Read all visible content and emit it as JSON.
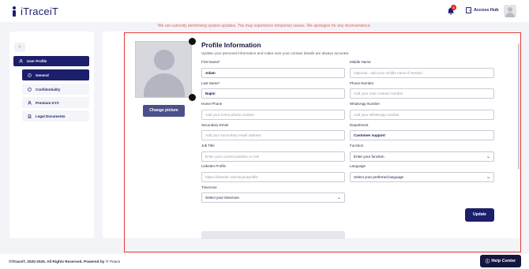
{
  "header": {
    "logo_text": "iTraceiT",
    "notification_count": "3",
    "access_hub_label": "Access Hub"
  },
  "notice": "We are currently performing system updates. You may experience temporary issues. We apologize for any inconvenience.",
  "sidebar": {
    "collapse_icon": "‹",
    "items": [
      {
        "label": "User Profile",
        "icon": "user-icon"
      },
      {
        "label": "General",
        "icon": "info-icon"
      },
      {
        "label": "Confidentiality",
        "icon": "shield-icon"
      },
      {
        "label": "Premium KYC",
        "icon": "person-icon"
      },
      {
        "label": "Legal Documents",
        "icon": "document-icon"
      }
    ]
  },
  "profile": {
    "change_picture_label": "Change picture",
    "title": "Profile Information",
    "subtitle": "Update your personal information and make sure your contact details are always accurate.",
    "fields": {
      "first_name": {
        "label": "First Name*",
        "value": "Adam",
        "placeholder": ""
      },
      "middle_name": {
        "label": "Middle Name",
        "value": "",
        "placeholder": "Optional - add your middle name if needed"
      },
      "last_name": {
        "label": "Last Name*",
        "value": "Najmi",
        "placeholder": ""
      },
      "phone_number": {
        "label": "Phone Number",
        "value": "",
        "placeholder": "Add your main contact number"
      },
      "home_phone": {
        "label": "Home Phone",
        "value": "",
        "placeholder": "Add your home phone number"
      },
      "whatsapp_number": {
        "label": "WhatsApp Number",
        "value": "",
        "placeholder": "Add your WhatsApp number"
      },
      "secondary_email": {
        "label": "Secondary Email",
        "value": "",
        "placeholder": "Add your secondary email address"
      },
      "department": {
        "label": "Department",
        "value": "Customer support",
        "placeholder": ""
      },
      "job_title": {
        "label": "Job Title",
        "value": "",
        "placeholder": "Enter your current position or role"
      },
      "function": {
        "label": "Function",
        "value": "Enter your function",
        "placeholder": ""
      },
      "linkedin": {
        "label": "LinkedIn Profile",
        "value": "",
        "placeholder": "https://linkedin.com/in/yourprofile"
      },
      "language": {
        "label": "Language",
        "value": "Select your preferred language",
        "placeholder": ""
      },
      "timezone": {
        "label": "Timezone",
        "value": "Select your timezone",
        "placeholder": ""
      }
    },
    "update_label": "Update"
  },
  "footer": {
    "copyright": "©iTraceiT, 2020-2025. All Rights Reserved. Powered by",
    "powered_by": "IT Peace",
    "help_label": "Help Center",
    "help_icon": "help-icon"
  },
  "colors": {
    "brand": "#1c1f6b",
    "notice": "#e4605e",
    "badge": "#e02424",
    "highlight": "#e53935"
  }
}
